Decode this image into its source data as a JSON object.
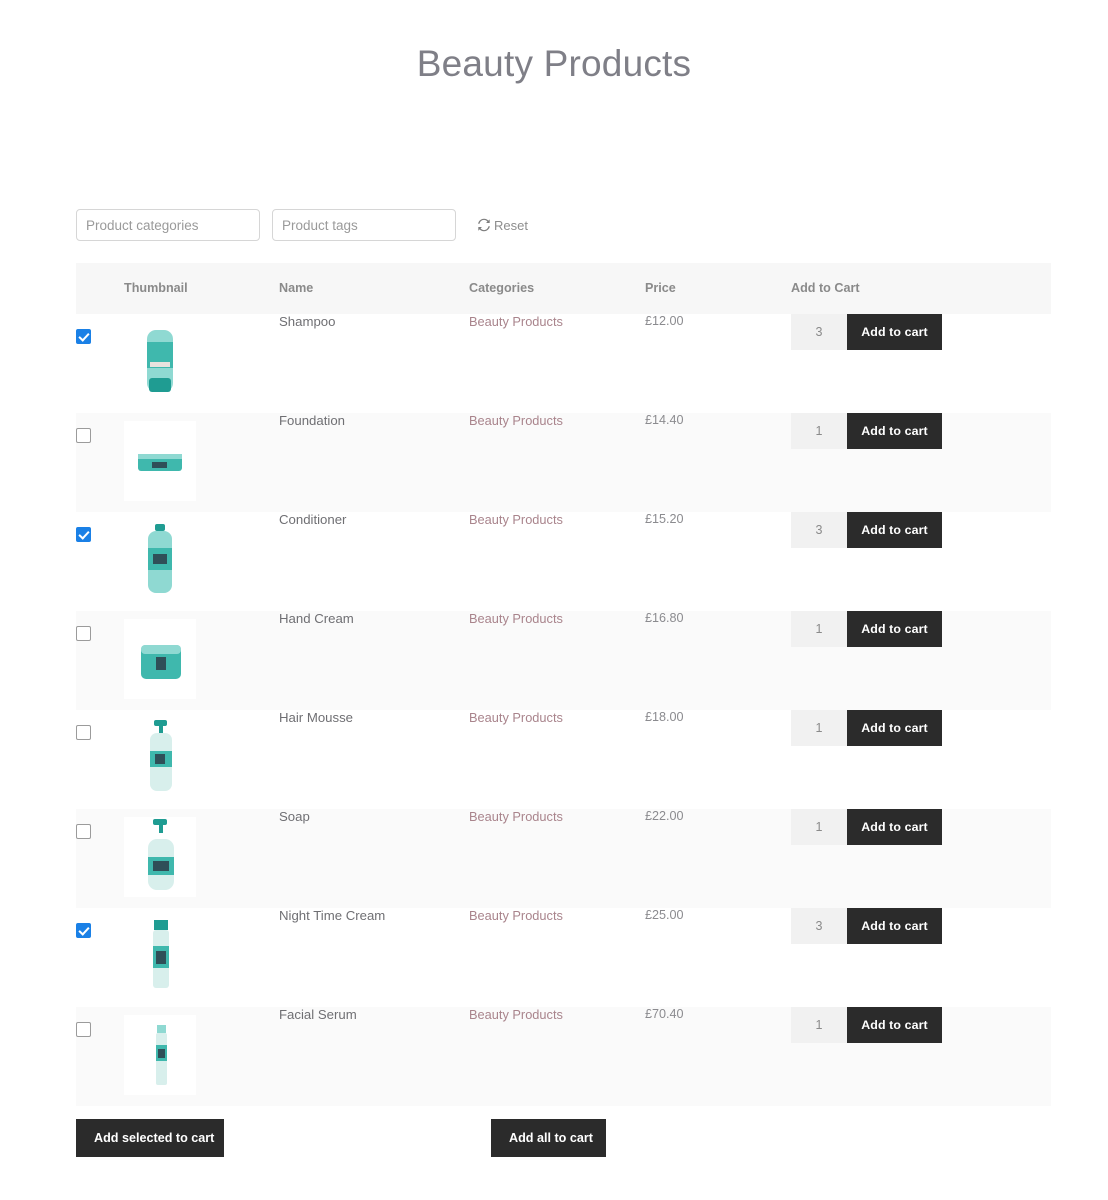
{
  "header": {
    "title": "Beauty Products"
  },
  "filters": {
    "categories_placeholder": "Product categories",
    "tags_placeholder": "Product tags",
    "reset_label": "Reset",
    "reset_icon": "refresh-icon"
  },
  "table": {
    "columns": [
      "",
      "Thumbnail",
      "Name",
      "Categories",
      "Price",
      "Add to Cart"
    ],
    "add_to_cart_label": "Add to cart",
    "rows": [
      {
        "selected": true,
        "name": "Shampoo",
        "category": "Beauty Products",
        "price": "£12.00",
        "quantity": "3",
        "thumbnail": "shampoo-bottle-thumbnail"
      },
      {
        "selected": false,
        "name": "Foundation",
        "category": "Beauty Products",
        "price": "£14.40",
        "quantity": "1",
        "thumbnail": "foundation-compact-thumbnail"
      },
      {
        "selected": true,
        "name": "Conditioner",
        "category": "Beauty Products",
        "price": "£15.20",
        "quantity": "3",
        "thumbnail": "conditioner-bottle-thumbnail"
      },
      {
        "selected": false,
        "name": "Hand Cream",
        "category": "Beauty Products",
        "price": "£16.80",
        "quantity": "1",
        "thumbnail": "hand-cream-jar-thumbnail"
      },
      {
        "selected": false,
        "name": "Hair Mousse",
        "category": "Beauty Products",
        "price": "£18.00",
        "quantity": "1",
        "thumbnail": "hair-mousse-pump-thumbnail"
      },
      {
        "selected": false,
        "name": "Soap",
        "category": "Beauty Products",
        "price": "£22.00",
        "quantity": "1",
        "thumbnail": "soap-pump-thumbnail"
      },
      {
        "selected": true,
        "name": "Night Time Cream",
        "category": "Beauty Products",
        "price": "£25.00",
        "quantity": "3",
        "thumbnail": "night-cream-tube-thumbnail"
      },
      {
        "selected": false,
        "name": "Facial Serum",
        "category": "Beauty Products",
        "price": "£70.40",
        "quantity": "1",
        "thumbnail": "facial-serum-tube-thumbnail"
      }
    ]
  },
  "footer": {
    "add_selected_label": "Add selected to cart",
    "add_all_label": "Add all to cart"
  },
  "colors": {
    "title": "#7f7f87",
    "accent_link": "#a9848c",
    "button_dark": "#2b2b2b",
    "checkbox_checked": "#1a80e6",
    "header_row": "#f7f7f7",
    "product_teal": "#3fb8ad"
  }
}
